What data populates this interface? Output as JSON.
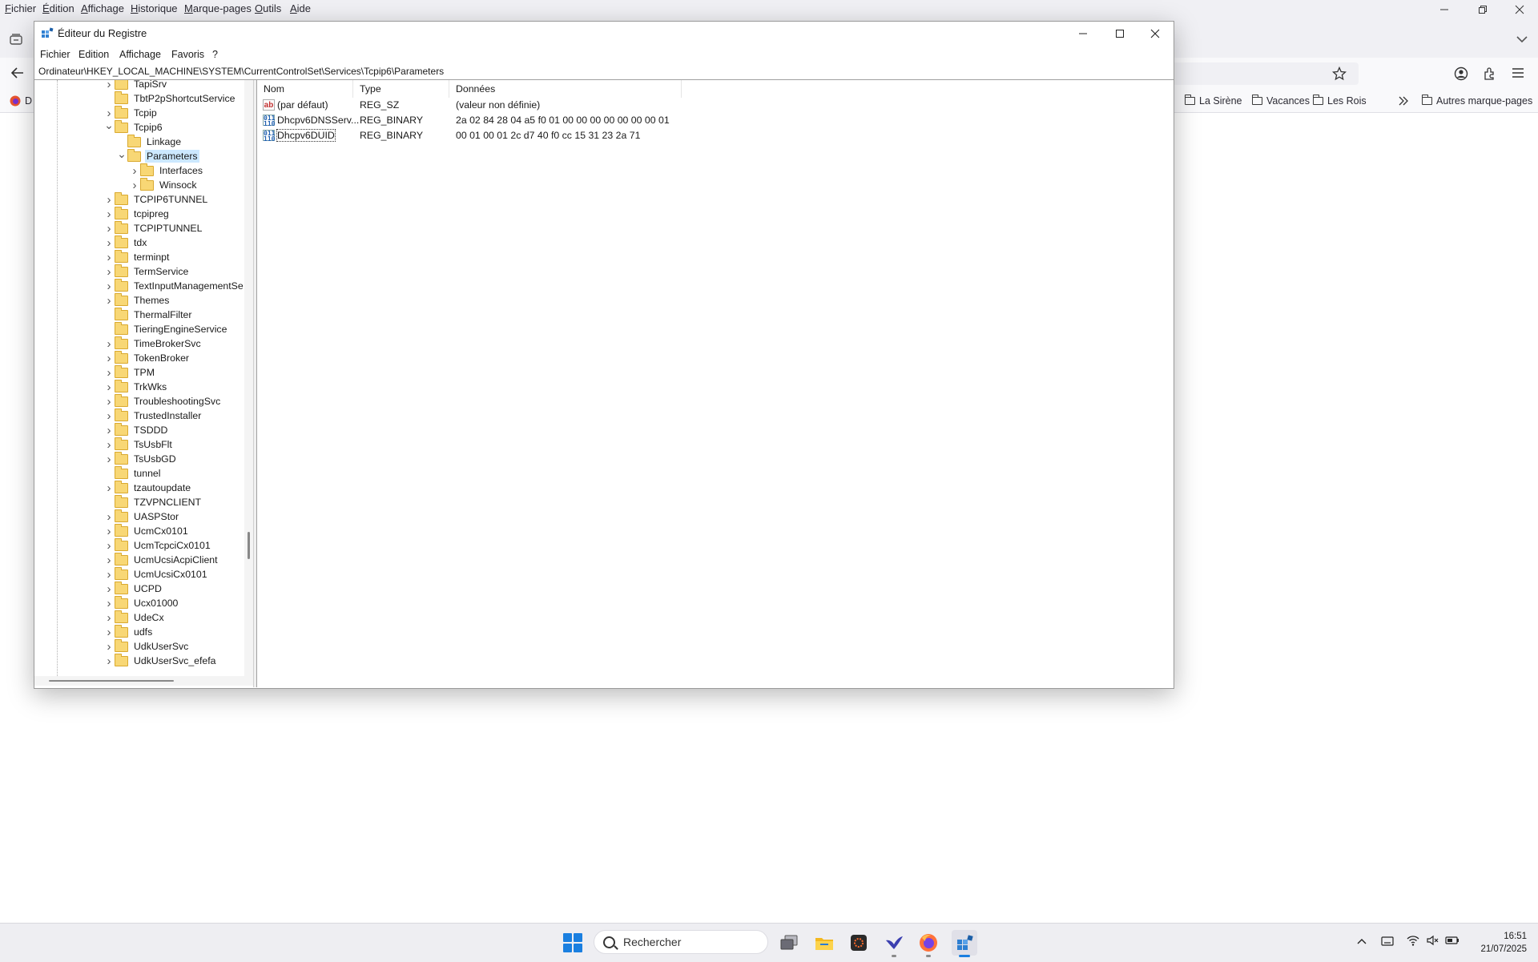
{
  "browser": {
    "menu": [
      "Fichier",
      "Édition",
      "Affichage",
      "Historique",
      "Marque-pages",
      "Outils",
      "Aide"
    ],
    "bookmark_partial": "D",
    "bookmarks": [
      "La Sirène",
      "Vacances",
      "Les Rois"
    ],
    "other_bookmarks": "Autres marque-pages"
  },
  "regedit": {
    "title": "Éditeur du Registre",
    "menu": [
      "Fichier",
      "Edition",
      "Affichage",
      "Favoris",
      "?"
    ],
    "address": "Ordinateur\\HKEY_LOCAL_MACHINE\\SYSTEM\\CurrentControlSet\\Services\\Tcpip6\\Parameters",
    "tree": [
      {
        "label": "TapiSrv",
        "level": 0,
        "expander": "collapsed"
      },
      {
        "label": "TbtP2pShortcutService",
        "level": 0,
        "expander": "none"
      },
      {
        "label": "Tcpip",
        "level": 0,
        "expander": "collapsed"
      },
      {
        "label": "Tcpip6",
        "level": 0,
        "expander": "expanded"
      },
      {
        "label": "Linkage",
        "level": 1,
        "expander": "none"
      },
      {
        "label": "Parameters",
        "level": 1,
        "expander": "expanded",
        "selected": true
      },
      {
        "label": "Interfaces",
        "level": 2,
        "expander": "collapsed"
      },
      {
        "label": "Winsock",
        "level": 2,
        "expander": "collapsed"
      },
      {
        "label": "TCPIP6TUNNEL",
        "level": 0,
        "expander": "collapsed"
      },
      {
        "label": "tcpipreg",
        "level": 0,
        "expander": "collapsed"
      },
      {
        "label": "TCPIPTUNNEL",
        "level": 0,
        "expander": "collapsed"
      },
      {
        "label": "tdx",
        "level": 0,
        "expander": "collapsed"
      },
      {
        "label": "terminpt",
        "level": 0,
        "expander": "collapsed"
      },
      {
        "label": "TermService",
        "level": 0,
        "expander": "collapsed"
      },
      {
        "label": "TextInputManagementSe",
        "level": 0,
        "expander": "collapsed"
      },
      {
        "label": "Themes",
        "level": 0,
        "expander": "collapsed"
      },
      {
        "label": "ThermalFilter",
        "level": 0,
        "expander": "none"
      },
      {
        "label": "TieringEngineService",
        "level": 0,
        "expander": "none"
      },
      {
        "label": "TimeBrokerSvc",
        "level": 0,
        "expander": "collapsed"
      },
      {
        "label": "TokenBroker",
        "level": 0,
        "expander": "collapsed"
      },
      {
        "label": "TPM",
        "level": 0,
        "expander": "collapsed"
      },
      {
        "label": "TrkWks",
        "level": 0,
        "expander": "collapsed"
      },
      {
        "label": "TroubleshootingSvc",
        "level": 0,
        "expander": "collapsed"
      },
      {
        "label": "TrustedInstaller",
        "level": 0,
        "expander": "collapsed"
      },
      {
        "label": "TSDDD",
        "level": 0,
        "expander": "collapsed"
      },
      {
        "label": "TsUsbFlt",
        "level": 0,
        "expander": "collapsed"
      },
      {
        "label": "TsUsbGD",
        "level": 0,
        "expander": "collapsed"
      },
      {
        "label": "tunnel",
        "level": 0,
        "expander": "none"
      },
      {
        "label": "tzautoupdate",
        "level": 0,
        "expander": "collapsed"
      },
      {
        "label": "TZVPNCLIENT",
        "level": 0,
        "expander": "none"
      },
      {
        "label": "UASPStor",
        "level": 0,
        "expander": "collapsed"
      },
      {
        "label": "UcmCx0101",
        "level": 0,
        "expander": "collapsed"
      },
      {
        "label": "UcmTcpciCx0101",
        "level": 0,
        "expander": "collapsed"
      },
      {
        "label": "UcmUcsiAcpiClient",
        "level": 0,
        "expander": "collapsed"
      },
      {
        "label": "UcmUcsiCx0101",
        "level": 0,
        "expander": "collapsed"
      },
      {
        "label": "UCPD",
        "level": 0,
        "expander": "collapsed"
      },
      {
        "label": "Ucx01000",
        "level": 0,
        "expander": "collapsed"
      },
      {
        "label": "UdeCx",
        "level": 0,
        "expander": "collapsed"
      },
      {
        "label": "udfs",
        "level": 0,
        "expander": "collapsed"
      },
      {
        "label": "UdkUserSvc",
        "level": 0,
        "expander": "collapsed"
      },
      {
        "label": "UdkUserSvc_efefa",
        "level": 0,
        "expander": "collapsed"
      }
    ],
    "columns": [
      "Nom",
      "Type",
      "Données"
    ],
    "values": [
      {
        "icon": "string-value-icon",
        "name": "(par défaut)",
        "type": "REG_SZ",
        "data": "(valeur non définie)"
      },
      {
        "icon": "binary-value-icon",
        "name": "Dhcpv6DNSServ...",
        "type": "REG_BINARY",
        "data": "2a 02 84 28 04 a5 f0 01 00 00 00 00 00 00 00 01"
      },
      {
        "icon": "binary-value-icon",
        "name": "Dhcpv6DUID",
        "type": "REG_BINARY",
        "data": "00 01 00 01 2c d7 40 f0 cc 15 31 23 2a 71",
        "focused": true
      }
    ]
  },
  "taskbar": {
    "search_placeholder": "Rechercher",
    "time": "16:51",
    "date": "21/07/2025",
    "accent": "#1a7fe0"
  }
}
